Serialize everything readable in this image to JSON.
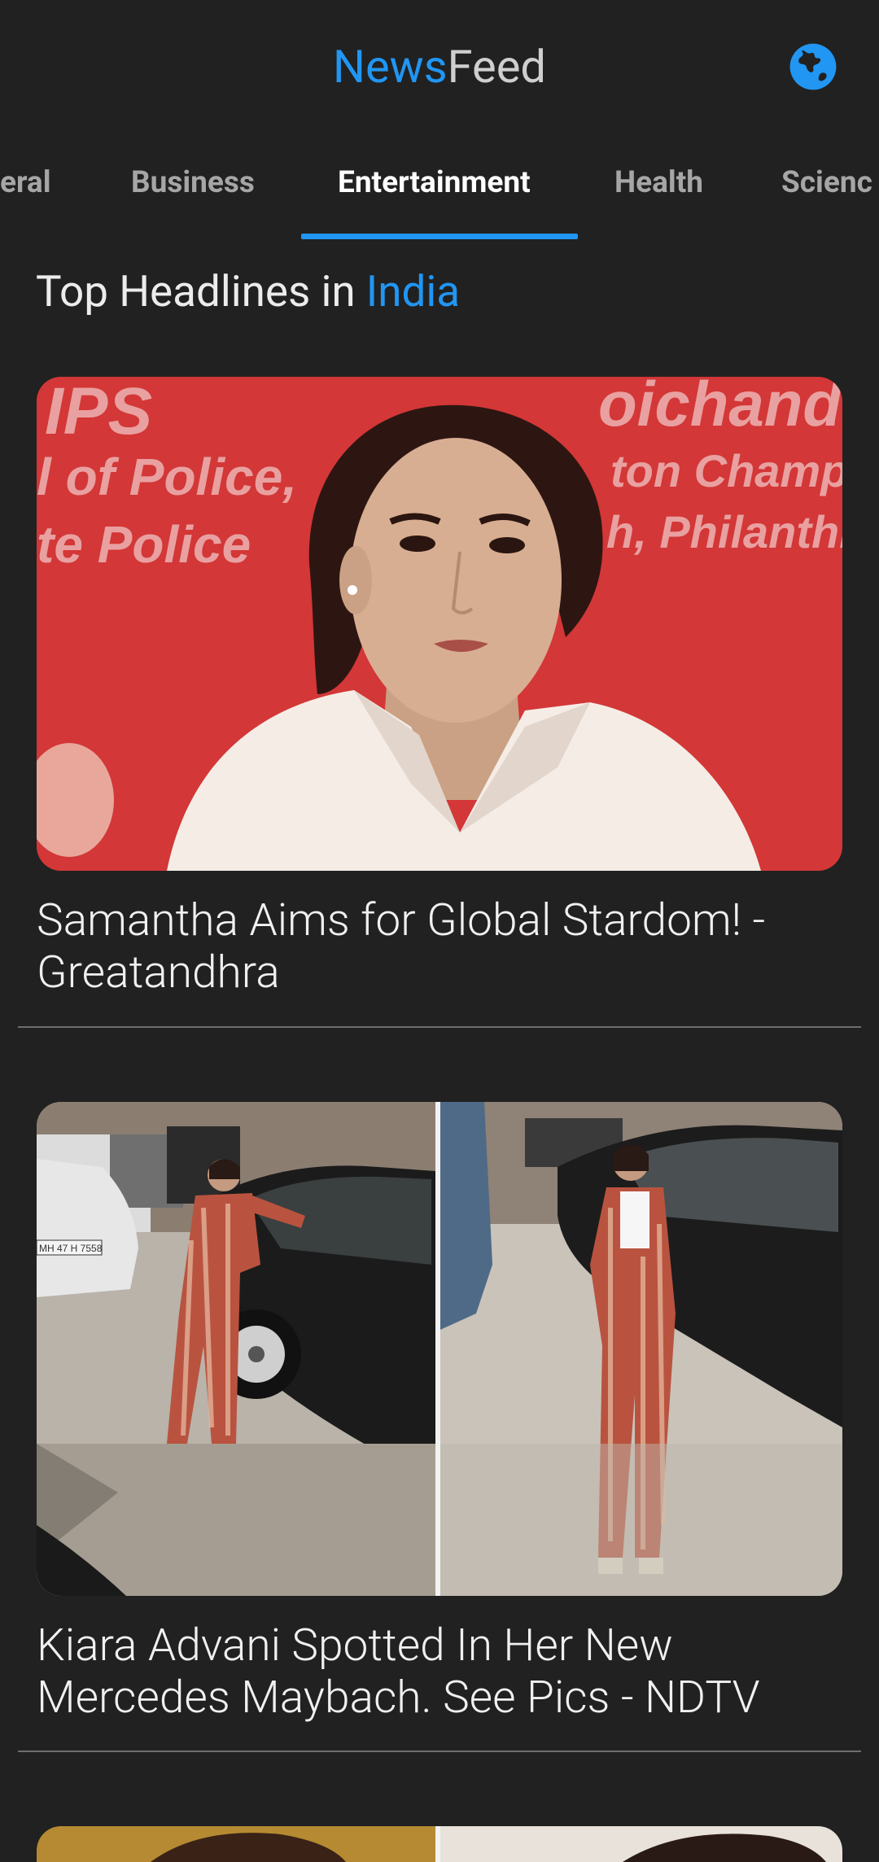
{
  "app": {
    "title_part1": "News",
    "title_part2": "Feed",
    "globe_icon": "globe-icon"
  },
  "tabs": [
    {
      "label": "eral",
      "active": false
    },
    {
      "label": "Business",
      "active": false
    },
    {
      "label": "Entertainment",
      "active": true
    },
    {
      "label": "Health",
      "active": false
    },
    {
      "label": "Scienc",
      "active": false
    }
  ],
  "heading": {
    "prefix": "Top Headlines in ",
    "country": "India"
  },
  "articles": [
    {
      "title": "Samantha Aims for Global Stardom! - Greatandhra"
    },
    {
      "title": "Kiara Advani Spotted In Her New Mercedes Maybach. See Pics - NDTV"
    }
  ],
  "photo_text": {
    "banner_left_1": "IPS",
    "banner_left_2": "l of Police,",
    "banner_left_3": "te Police",
    "banner_right_1": "oichand",
    "banner_right_2": "ton Champ",
    "banner_right_3": "h, Philanthr",
    "plate": "MH 47 H 7558"
  },
  "colors": {
    "background": "#212121",
    "accent": "#2196F3",
    "tab_inactive": "#a6a6a6",
    "divider": "#6e6e6e"
  }
}
